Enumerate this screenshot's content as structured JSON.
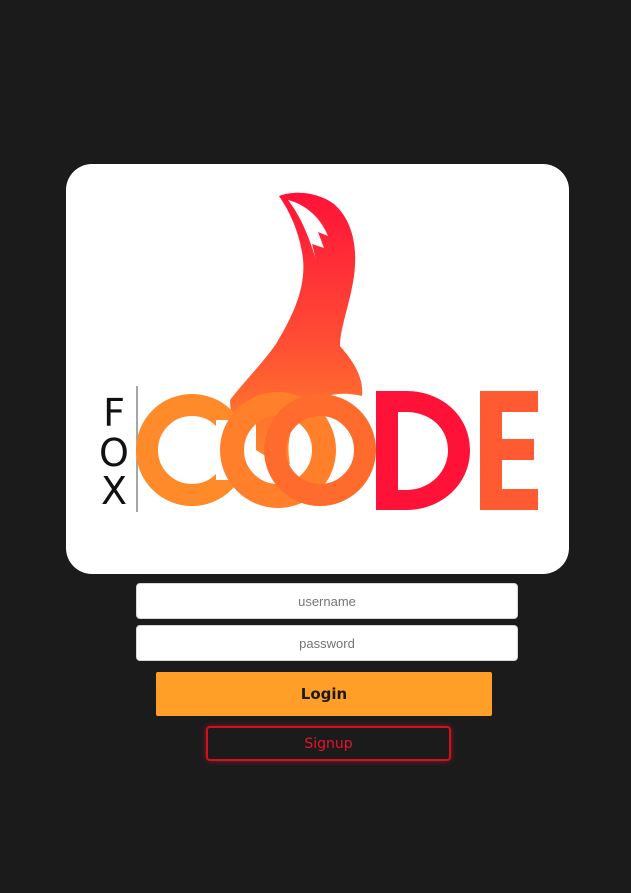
{
  "logo": {
    "vertical_text": [
      "F",
      "O",
      "X"
    ],
    "word_letters": [
      "C",
      "O",
      "D",
      "E"
    ]
  },
  "form": {
    "username_placeholder": "username",
    "password_placeholder": "password",
    "login_label": "Login",
    "signup_label": "Signup"
  },
  "colors": {
    "background": "#1b1b1c",
    "card": "#ffffff",
    "login_button": "#ff9f27",
    "signup_accent": "#e8142a",
    "gradient_orange": "#ff8a2a",
    "gradient_red": "#ff1238"
  }
}
